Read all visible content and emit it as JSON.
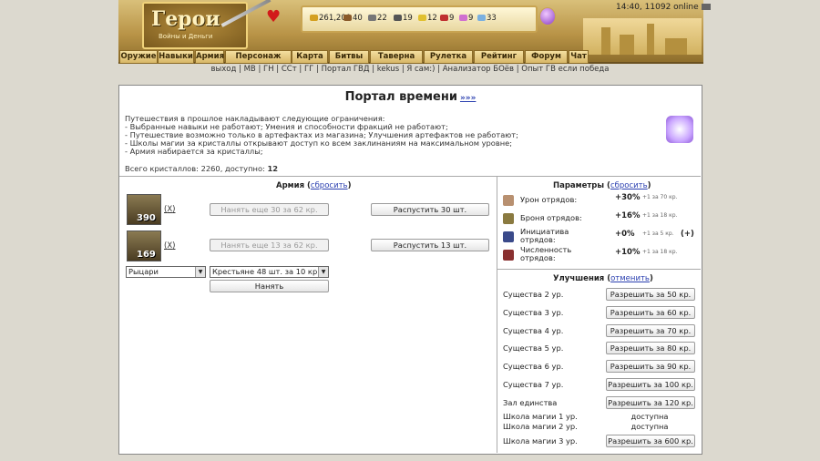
{
  "header": {
    "logo_title": "Герои",
    "logo_subtitle": "Войны и Деньги",
    "resources": [
      {
        "icon": "gold-icon",
        "value": "261,200",
        "color": "#d4a020"
      },
      {
        "icon": "wood-icon",
        "value": "40",
        "color": "#8a5a2a"
      },
      {
        "icon": "ore-icon",
        "value": "22",
        "color": "#777777"
      },
      {
        "icon": "mercury-icon",
        "value": "19",
        "color": "#555555"
      },
      {
        "icon": "sulfur-icon",
        "value": "12",
        "color": "#e0c030"
      },
      {
        "icon": "crystal-icon",
        "value": "9",
        "color": "#c03030"
      },
      {
        "icon": "gems-icon",
        "value": "9",
        "color": "#d070d0"
      },
      {
        "icon": "diamond-icon",
        "value": "33",
        "color": "#7ab0e0"
      }
    ],
    "clock": "14:40, 11092 online"
  },
  "nav": [
    "Оружие",
    "Навыки",
    "Армия",
    "Персонаж",
    "Карта",
    "Битвы",
    "Таверна",
    "Рулетка",
    "Рейтинг",
    "Форум",
    "Чат"
  ],
  "links": "выход | МВ | ГН | ССт | ГГ | Портал ГВД | kekus | Я сам:) | Анализатор БОёв | Опыт ГВ если победа",
  "portal": {
    "title": "Портал времени",
    "more": "»»»",
    "description": "Путешествия в прошлое накладывают следующие ограничения:\n- Выбранные навыки не работают; Умения и способности фракций не работают;\n- Путешествие возможно только в артефактах из магазина; Улучшения артефактов не работают;\n- Школы магии за кристаллы открывают доступ ко всем заклинаниям на максимальном уровне;\n- Армия набирается за кристаллы;",
    "total_label": "Всего кристаллов: 2260, доступно:",
    "available": "12"
  },
  "army": {
    "title": "Армия",
    "reset": "сбросить",
    "units": [
      {
        "count": "390",
        "remove": "X",
        "hire": "Нанять еще 30 за 62 кр.",
        "dismiss": "Распустить 30 шт."
      },
      {
        "count": "169",
        "remove": "X",
        "hire": "Нанять еще 13 за 62 кр.",
        "dismiss": "Распустить 13 шт."
      }
    ],
    "faction_select": "Рыцари",
    "unit_select": "Крестьяне 48 шт. за 10 кр.",
    "hire_button": "Нанять"
  },
  "params": {
    "title": "Параметры",
    "reset": "сбросить",
    "rows": [
      {
        "label": "Урон отрядов:",
        "value": "+30%",
        "step": "+1 за 70 кр.",
        "icon": "damage-icon",
        "color": "#b89070"
      },
      {
        "label": "Броня отрядов:",
        "value": "+16%",
        "step": "+1 за 18 кр.",
        "icon": "armor-icon",
        "color": "#8a7a40"
      },
      {
        "label": "Инициатива отрядов:",
        "value": "+0%",
        "step": "+1 за 5 кр.",
        "icon": "initiative-icon",
        "color": "#3a4a8a"
      },
      {
        "label": "Численность отрядов:",
        "value": "+10%",
        "step": "+1 за 18 кр.",
        "icon": "count-icon",
        "color": "#8a3030"
      }
    ],
    "plus": "(+)"
  },
  "upgrades": {
    "title": "Улучшения",
    "cancel": "отменить",
    "rows": [
      {
        "label": "Существа 2 ур.",
        "action": "Разрешить за 50 кр."
      },
      {
        "label": "Существа 3 ур.",
        "action": "Разрешить за 60 кр."
      },
      {
        "label": "Существа 4 ур.",
        "action": "Разрешить за 70 кр."
      },
      {
        "label": "Существа 5 ур.",
        "action": "Разрешить за 80 кр."
      },
      {
        "label": "Существа 6 ур.",
        "action": "Разрешить за 90 кр."
      },
      {
        "label": "Существа 7 ур.",
        "action": "Разрешить за 100 кр."
      },
      {
        "label": "Зал единства",
        "action": "Разрешить за 120 кр."
      }
    ],
    "schools": [
      {
        "label": "Школа магии 1 ур.",
        "status": "доступна"
      },
      {
        "label": "Школа магии 2 ур.",
        "status": "доступна"
      },
      {
        "label": "Школа магии 3 ур.",
        "action": "Разрешить за 600 кр."
      }
    ]
  }
}
